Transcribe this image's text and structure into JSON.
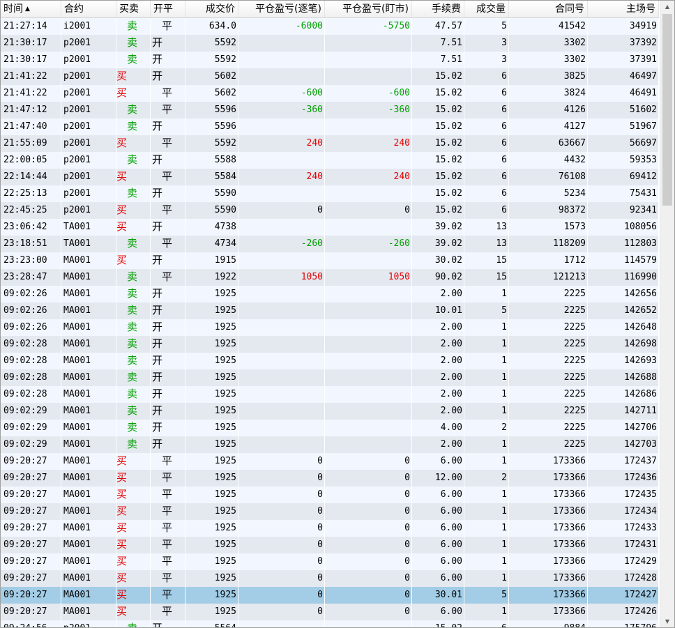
{
  "columns": [
    {
      "key": "time",
      "label": "时间",
      "sorted": true,
      "sort_icon": "▲",
      "align": "l"
    },
    {
      "key": "contract",
      "label": "合约",
      "align": "l"
    },
    {
      "key": "side",
      "label": "买卖",
      "align": "l"
    },
    {
      "key": "openclose",
      "label": "开平",
      "align": "l"
    },
    {
      "key": "price",
      "label": "成交价",
      "align": "r"
    },
    {
      "key": "pnl_trade",
      "label": "平仓盈亏(逐笔)",
      "align": "r"
    },
    {
      "key": "pnl_mtm",
      "label": "平仓盈亏(盯市)",
      "align": "r"
    },
    {
      "key": "fee",
      "label": "手续费",
      "align": "r"
    },
    {
      "key": "qty",
      "label": "成交量",
      "align": "r"
    },
    {
      "key": "contract_no",
      "label": "合同号",
      "align": "r"
    },
    {
      "key": "exchange_no",
      "label": "主场号",
      "align": "r"
    }
  ],
  "colors": {
    "buy": "#e60000",
    "sell": "#00a000",
    "selected_row": "#a3cde7"
  },
  "selected_row_index": 34,
  "rows": [
    {
      "time": "21:27:14",
      "contract": "i2001",
      "side": "卖",
      "openclose": "平",
      "price": "634.0",
      "pnl_trade": "-6000",
      "pnl_mtm": "-5750",
      "fee": "47.57",
      "qty": "5",
      "contract_no": "41542",
      "exchange_no": "34919"
    },
    {
      "time": "21:30:17",
      "contract": "p2001",
      "side": "卖",
      "openclose": "开",
      "price": "5592",
      "pnl_trade": "",
      "pnl_mtm": "",
      "fee": "7.51",
      "qty": "3",
      "contract_no": "3302",
      "exchange_no": "37392"
    },
    {
      "time": "21:30:17",
      "contract": "p2001",
      "side": "卖",
      "openclose": "开",
      "price": "5592",
      "pnl_trade": "",
      "pnl_mtm": "",
      "fee": "7.51",
      "qty": "3",
      "contract_no": "3302",
      "exchange_no": "37391"
    },
    {
      "time": "21:41:22",
      "contract": "p2001",
      "side": "买",
      "openclose": "开",
      "price": "5602",
      "pnl_trade": "",
      "pnl_mtm": "",
      "fee": "15.02",
      "qty": "6",
      "contract_no": "3825",
      "exchange_no": "46497"
    },
    {
      "time": "21:41:22",
      "contract": "p2001",
      "side": "买",
      "openclose": "平",
      "price": "5602",
      "pnl_trade": "-600",
      "pnl_mtm": "-600",
      "fee": "15.02",
      "qty": "6",
      "contract_no": "3824",
      "exchange_no": "46491"
    },
    {
      "time": "21:47:12",
      "contract": "p2001",
      "side": "卖",
      "openclose": "平",
      "price": "5596",
      "pnl_trade": "-360",
      "pnl_mtm": "-360",
      "fee": "15.02",
      "qty": "6",
      "contract_no": "4126",
      "exchange_no": "51602"
    },
    {
      "time": "21:47:40",
      "contract": "p2001",
      "side": "卖",
      "openclose": "开",
      "price": "5596",
      "pnl_trade": "",
      "pnl_mtm": "",
      "fee": "15.02",
      "qty": "6",
      "contract_no": "4127",
      "exchange_no": "51967"
    },
    {
      "time": "21:55:09",
      "contract": "p2001",
      "side": "买",
      "openclose": "平",
      "price": "5592",
      "pnl_trade": "240",
      "pnl_mtm": "240",
      "fee": "15.02",
      "qty": "6",
      "contract_no": "63667",
      "exchange_no": "56697"
    },
    {
      "time": "22:00:05",
      "contract": "p2001",
      "side": "卖",
      "openclose": "开",
      "price": "5588",
      "pnl_trade": "",
      "pnl_mtm": "",
      "fee": "15.02",
      "qty": "6",
      "contract_no": "4432",
      "exchange_no": "59353"
    },
    {
      "time": "22:14:44",
      "contract": "p2001",
      "side": "买",
      "openclose": "平",
      "price": "5584",
      "pnl_trade": "240",
      "pnl_mtm": "240",
      "fee": "15.02",
      "qty": "6",
      "contract_no": "76108",
      "exchange_no": "69412"
    },
    {
      "time": "22:25:13",
      "contract": "p2001",
      "side": "卖",
      "openclose": "开",
      "price": "5590",
      "pnl_trade": "",
      "pnl_mtm": "",
      "fee": "15.02",
      "qty": "6",
      "contract_no": "5234",
      "exchange_no": "75431"
    },
    {
      "time": "22:45:25",
      "contract": "p2001",
      "side": "买",
      "openclose": "平",
      "price": "5590",
      "pnl_trade": "0",
      "pnl_mtm": "0",
      "fee": "15.02",
      "qty": "6",
      "contract_no": "98372",
      "exchange_no": "92341"
    },
    {
      "time": "23:06:42",
      "contract": "TA001",
      "side": "买",
      "openclose": "开",
      "price": "4738",
      "pnl_trade": "",
      "pnl_mtm": "",
      "fee": "39.02",
      "qty": "13",
      "contract_no": "1573",
      "exchange_no": "108056"
    },
    {
      "time": "23:18:51",
      "contract": "TA001",
      "side": "卖",
      "openclose": "平",
      "price": "4734",
      "pnl_trade": "-260",
      "pnl_mtm": "-260",
      "fee": "39.02",
      "qty": "13",
      "contract_no": "118209",
      "exchange_no": "112803"
    },
    {
      "time": "23:23:00",
      "contract": "MA001",
      "side": "买",
      "openclose": "开",
      "price": "1915",
      "pnl_trade": "",
      "pnl_mtm": "",
      "fee": "30.02",
      "qty": "15",
      "contract_no": "1712",
      "exchange_no": "114579"
    },
    {
      "time": "23:28:47",
      "contract": "MA001",
      "side": "卖",
      "openclose": "平",
      "price": "1922",
      "pnl_trade": "1050",
      "pnl_mtm": "1050",
      "fee": "90.02",
      "qty": "15",
      "contract_no": "121213",
      "exchange_no": "116990"
    },
    {
      "time": "09:02:26",
      "contract": "MA001",
      "side": "卖",
      "openclose": "开",
      "price": "1925",
      "pnl_trade": "",
      "pnl_mtm": "",
      "fee": "2.00",
      "qty": "1",
      "contract_no": "2225",
      "exchange_no": "142656"
    },
    {
      "time": "09:02:26",
      "contract": "MA001",
      "side": "卖",
      "openclose": "开",
      "price": "1925",
      "pnl_trade": "",
      "pnl_mtm": "",
      "fee": "10.01",
      "qty": "5",
      "contract_no": "2225",
      "exchange_no": "142652"
    },
    {
      "time": "09:02:26",
      "contract": "MA001",
      "side": "卖",
      "openclose": "开",
      "price": "1925",
      "pnl_trade": "",
      "pnl_mtm": "",
      "fee": "2.00",
      "qty": "1",
      "contract_no": "2225",
      "exchange_no": "142648"
    },
    {
      "time": "09:02:28",
      "contract": "MA001",
      "side": "卖",
      "openclose": "开",
      "price": "1925",
      "pnl_trade": "",
      "pnl_mtm": "",
      "fee": "2.00",
      "qty": "1",
      "contract_no": "2225",
      "exchange_no": "142698"
    },
    {
      "time": "09:02:28",
      "contract": "MA001",
      "side": "卖",
      "openclose": "开",
      "price": "1925",
      "pnl_trade": "",
      "pnl_mtm": "",
      "fee": "2.00",
      "qty": "1",
      "contract_no": "2225",
      "exchange_no": "142693"
    },
    {
      "time": "09:02:28",
      "contract": "MA001",
      "side": "卖",
      "openclose": "开",
      "price": "1925",
      "pnl_trade": "",
      "pnl_mtm": "",
      "fee": "2.00",
      "qty": "1",
      "contract_no": "2225",
      "exchange_no": "142688"
    },
    {
      "time": "09:02:28",
      "contract": "MA001",
      "side": "卖",
      "openclose": "开",
      "price": "1925",
      "pnl_trade": "",
      "pnl_mtm": "",
      "fee": "2.00",
      "qty": "1",
      "contract_no": "2225",
      "exchange_no": "142686"
    },
    {
      "time": "09:02:29",
      "contract": "MA001",
      "side": "卖",
      "openclose": "开",
      "price": "1925",
      "pnl_trade": "",
      "pnl_mtm": "",
      "fee": "2.00",
      "qty": "1",
      "contract_no": "2225",
      "exchange_no": "142711"
    },
    {
      "time": "09:02:29",
      "contract": "MA001",
      "side": "卖",
      "openclose": "开",
      "price": "1925",
      "pnl_trade": "",
      "pnl_mtm": "",
      "fee": "4.00",
      "qty": "2",
      "contract_no": "2225",
      "exchange_no": "142706"
    },
    {
      "time": "09:02:29",
      "contract": "MA001",
      "side": "卖",
      "openclose": "开",
      "price": "1925",
      "pnl_trade": "",
      "pnl_mtm": "",
      "fee": "2.00",
      "qty": "1",
      "contract_no": "2225",
      "exchange_no": "142703"
    },
    {
      "time": "09:20:27",
      "contract": "MA001",
      "side": "买",
      "openclose": "平",
      "price": "1925",
      "pnl_trade": "0",
      "pnl_mtm": "0",
      "fee": "6.00",
      "qty": "1",
      "contract_no": "173366",
      "exchange_no": "172437"
    },
    {
      "time": "09:20:27",
      "contract": "MA001",
      "side": "买",
      "openclose": "平",
      "price": "1925",
      "pnl_trade": "0",
      "pnl_mtm": "0",
      "fee": "12.00",
      "qty": "2",
      "contract_no": "173366",
      "exchange_no": "172436"
    },
    {
      "time": "09:20:27",
      "contract": "MA001",
      "side": "买",
      "openclose": "平",
      "price": "1925",
      "pnl_trade": "0",
      "pnl_mtm": "0",
      "fee": "6.00",
      "qty": "1",
      "contract_no": "173366",
      "exchange_no": "172435"
    },
    {
      "time": "09:20:27",
      "contract": "MA001",
      "side": "买",
      "openclose": "平",
      "price": "1925",
      "pnl_trade": "0",
      "pnl_mtm": "0",
      "fee": "6.00",
      "qty": "1",
      "contract_no": "173366",
      "exchange_no": "172434"
    },
    {
      "time": "09:20:27",
      "contract": "MA001",
      "side": "买",
      "openclose": "平",
      "price": "1925",
      "pnl_trade": "0",
      "pnl_mtm": "0",
      "fee": "6.00",
      "qty": "1",
      "contract_no": "173366",
      "exchange_no": "172433"
    },
    {
      "time": "09:20:27",
      "contract": "MA001",
      "side": "买",
      "openclose": "平",
      "price": "1925",
      "pnl_trade": "0",
      "pnl_mtm": "0",
      "fee": "6.00",
      "qty": "1",
      "contract_no": "173366",
      "exchange_no": "172431"
    },
    {
      "time": "09:20:27",
      "contract": "MA001",
      "side": "买",
      "openclose": "平",
      "price": "1925",
      "pnl_trade": "0",
      "pnl_mtm": "0",
      "fee": "6.00",
      "qty": "1",
      "contract_no": "173366",
      "exchange_no": "172429"
    },
    {
      "time": "09:20:27",
      "contract": "MA001",
      "side": "买",
      "openclose": "平",
      "price": "1925",
      "pnl_trade": "0",
      "pnl_mtm": "0",
      "fee": "6.00",
      "qty": "1",
      "contract_no": "173366",
      "exchange_no": "172428"
    },
    {
      "time": "09:20:27",
      "contract": "MA001",
      "side": "买",
      "openclose": "平",
      "price": "1925",
      "pnl_trade": "0",
      "pnl_mtm": "0",
      "fee": "30.01",
      "qty": "5",
      "contract_no": "173366",
      "exchange_no": "172427"
    },
    {
      "time": "09:20:27",
      "contract": "MA001",
      "side": "买",
      "openclose": "平",
      "price": "1925",
      "pnl_trade": "0",
      "pnl_mtm": "0",
      "fee": "6.00",
      "qty": "1",
      "contract_no": "173366",
      "exchange_no": "172426"
    },
    {
      "time": "09:24:56",
      "contract": "p2001",
      "side": "卖",
      "openclose": "开",
      "price": "5564",
      "pnl_trade": "",
      "pnl_mtm": "",
      "fee": "15.02",
      "qty": "6",
      "contract_no": "9884",
      "exchange_no": "175796"
    }
  ],
  "scrollbar": {
    "up_icon": "▲",
    "down_icon": "▼"
  }
}
